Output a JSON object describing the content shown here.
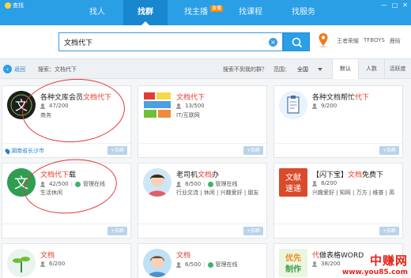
{
  "window": {
    "title": "查找",
    "controls": [
      "—",
      "□",
      "✕"
    ]
  },
  "nav": {
    "items": [
      {
        "label": "找人",
        "active": false
      },
      {
        "label": "找群",
        "active": true
      },
      {
        "label": "找主播",
        "active": false,
        "badge": "直播"
      },
      {
        "label": "找课程",
        "active": false
      },
      {
        "label": "找服务",
        "active": false
      }
    ]
  },
  "search": {
    "value": "文档代下",
    "clear_glyph": "×",
    "hot_words": [
      "王者荣耀",
      "TFBOYS",
      "鹿晗"
    ]
  },
  "filter": {
    "back_label": "返回",
    "breadcrumb": "搜索：文档代下",
    "not_found": "搜索不到我的群？",
    "range_label": "范围：",
    "range_value": "全国",
    "sort_tabs": [
      {
        "label": "默认",
        "active": true
      },
      {
        "label": "人数",
        "active": false
      },
      {
        "label": "活跃度",
        "active": false
      }
    ]
  },
  "cards": [
    {
      "title_pre": "各种文库会员",
      "title_hl": "文档代下",
      "title_post": "",
      "count": "47/200",
      "tags": "商务",
      "location": "湖南省长沙市",
      "join": "+加群",
      "managed": ""
    },
    {
      "title_pre": "",
      "title_hl": "文档代下",
      "title_post": "",
      "count": "13/500",
      "tags": "IT/互联网",
      "location": "",
      "join": "+加群",
      "managed": ""
    },
    {
      "title_pre": "各种文档帮忙",
      "title_hl": "代下",
      "title_post": "",
      "count": "9/200",
      "tags": "",
      "location": "",
      "join": "+加群",
      "managed": ""
    },
    {
      "title_pre": "",
      "title_hl": "文档代下",
      "title_post": "载",
      "count": "42/500",
      "tags": "生活休闲",
      "location": "",
      "join": "+加群",
      "managed": "管理在线"
    },
    {
      "title_pre": "老司机",
      "title_hl": "文档",
      "title_post": "办",
      "count": "8/500",
      "tags": "行业交流 | 休闲 | 兴趣爱好 | 朋友",
      "location": "",
      "join": "+加群",
      "managed": "管理在线"
    },
    {
      "title_pre": "【闪下宝】",
      "title_hl": "文档",
      "title_post": "免费下",
      "count": "8/200",
      "tags": "兴趣爱好 | 知网 | 万方 | 维普 | 英",
      "location": "",
      "join": "+加群",
      "managed": ""
    },
    {
      "title_pre": "",
      "title_hl": "文档",
      "title_post": "",
      "count": "6/200",
      "tags": "",
      "location": "",
      "join": "+加群",
      "managed": ""
    },
    {
      "title_pre": "",
      "title_hl": "文档",
      "title_post": "",
      "count": "6/500",
      "tags": "",
      "location": "",
      "join": "+加群",
      "managed": "管理在线"
    },
    {
      "title_pre": "",
      "title_hl": "代",
      "title_post": "做表格WORD",
      "count": "38/200",
      "tags": "",
      "location": "",
      "join": "+加群",
      "managed": ""
    }
  ],
  "card_icons": {
    "c0": "文",
    "c3": "文",
    "c5_line1": "文献",
    "c5_line2": "速递",
    "c8_line1": "优先",
    "c8_line2": "制作"
  },
  "watermark": {
    "main": "中赚网",
    "url": "www.you85.com"
  },
  "colors": {
    "nav_bg": "#2a9fe6",
    "highlight_red": "#e53a2b",
    "join_button": "#b9d3ec",
    "annotation_red": "#e23b3b"
  }
}
